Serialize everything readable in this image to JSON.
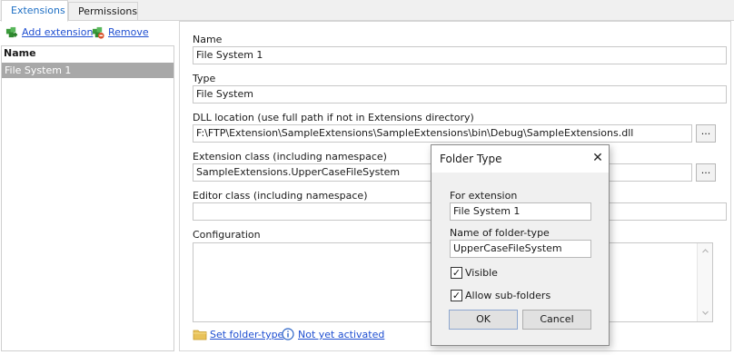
{
  "tabs": [
    {
      "label": "Extensions",
      "active": true
    },
    {
      "label": "Permissions",
      "active": false
    }
  ],
  "toolbar": {
    "add_label": "Add extension",
    "add_icon": "add-extension-icon",
    "remove_label": "Remove",
    "remove_icon": "remove-extension-icon"
  },
  "list": {
    "header": "Name",
    "items": [
      "File System 1"
    ]
  },
  "form": {
    "name_label": "Name",
    "name_value": "File System 1",
    "type_label": "Type",
    "type_value": "File System",
    "dll_label": "DLL location (use full path if not in Extensions directory)",
    "dll_value": "F:\\FTP\\Extension\\SampleExtensions\\SampleExtensions\\bin\\Debug\\SampleExtensions.dll",
    "ext_class_label": "Extension class (including namespace)",
    "ext_class_value": "SampleExtensions.UpperCaseFileSystem",
    "editor_class_label": "Editor class (including namespace)",
    "editor_class_value": "",
    "config_label": "Configuration",
    "browse_label": "...",
    "set_folder_type_label": "Set folder-type",
    "not_activated_label": "Not yet activated"
  },
  "dialog": {
    "title": "Folder Type",
    "for_extension_label": "For extension",
    "for_extension_value": "File System 1",
    "name_label": "Name of folder-type",
    "name_value": "UpperCaseFileSystem",
    "visible_label": "Visible",
    "visible_checked": true,
    "allow_subfolders_label": "Allow sub-folders",
    "allow_subfolders_checked": true,
    "ok_label": "OK",
    "cancel_label": "Cancel",
    "close_glyph": "✕"
  },
  "colors": {
    "accent": "#1e6fc4",
    "link": "#1f4fd1",
    "selection": "#a8a8a8"
  }
}
